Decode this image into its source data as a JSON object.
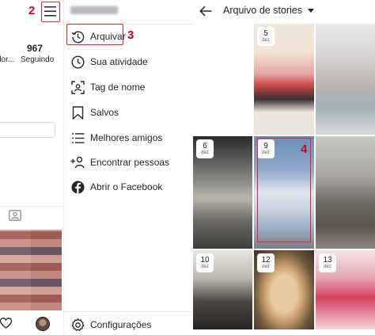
{
  "annotations": {
    "step_2": "2",
    "step_3": "3",
    "step_4": "4"
  },
  "profile": {
    "stat_partial_label": "dor...",
    "stat_following_value": "967",
    "stat_following_label": "Seguindo"
  },
  "menu": {
    "items": [
      {
        "label": "Arquivar",
        "icon": "archive-clock-icon"
      },
      {
        "label": "Sua atividade",
        "icon": "activity-icon"
      },
      {
        "label": "Tag de nome",
        "icon": "nametag-icon"
      },
      {
        "label": "Salvos",
        "icon": "bookmark-icon"
      },
      {
        "label": "Melhores amigos",
        "icon": "close-friends-list-icon"
      },
      {
        "label": "Encontrar pessoas",
        "icon": "add-person-icon"
      },
      {
        "label": "Abrir o Facebook",
        "icon": "facebook-icon"
      }
    ],
    "settings_label": "Configurações"
  },
  "archive": {
    "title": "Arquivo de stories",
    "stories": [
      {
        "day": "5",
        "month": "dez"
      },
      {
        "day": "6",
        "month": "dez"
      },
      {
        "day": "9",
        "month": "dez"
      },
      {
        "day": "10",
        "month": "dez"
      },
      {
        "day": "12",
        "month": "dez"
      },
      {
        "day": "13",
        "month": "dez"
      }
    ]
  },
  "colors": {
    "annotation_red": "#e0262a",
    "text": "#262626"
  }
}
